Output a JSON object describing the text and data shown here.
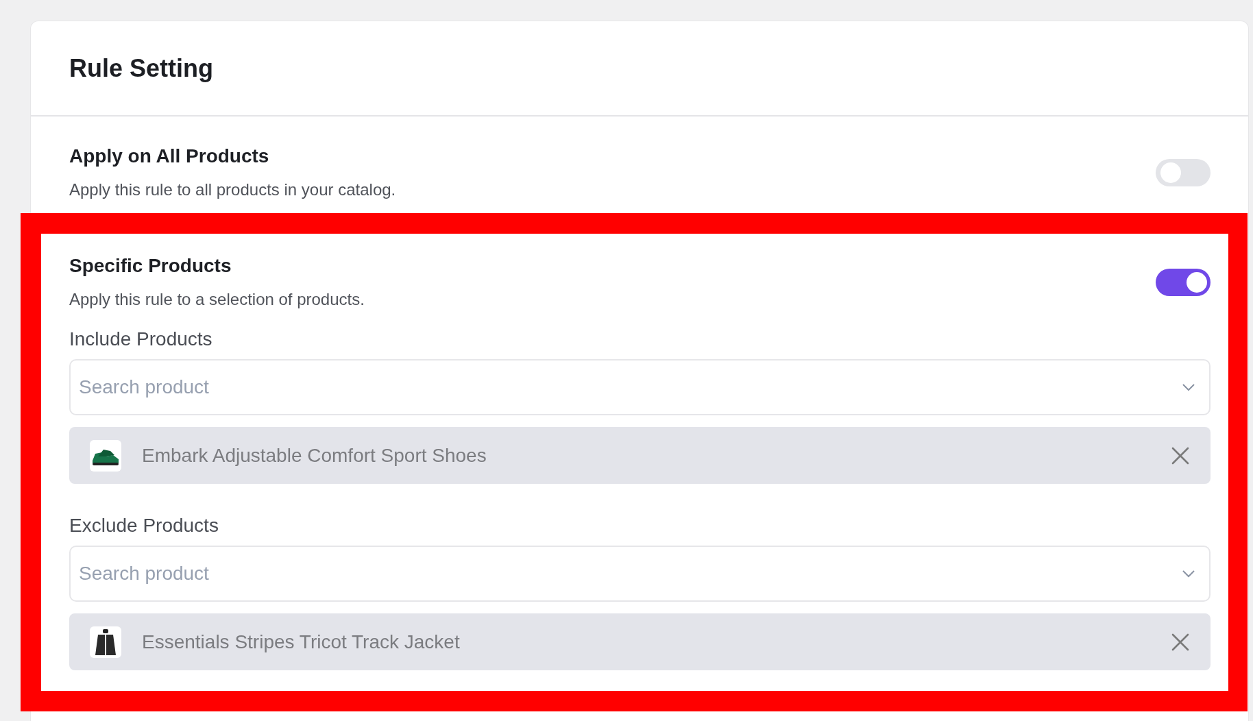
{
  "title": "Rule Setting",
  "rules": [
    {
      "title": "Apply on All Products",
      "description": "Apply this rule to all products in your catalog.",
      "on": false
    },
    {
      "title": "Specific Products",
      "description": "Apply this rule to a selection of products.",
      "on": true,
      "groups": [
        {
          "label": "Include Products",
          "placeholder": "Search product",
          "items": [
            {
              "name": "Embark Adjustable Comfort Sport Shoes"
            }
          ]
        },
        {
          "label": "Exclude Products",
          "placeholder": "Search product",
          "items": [
            {
              "name": "Essentials Stripes Tricot Track Jacket"
            }
          ]
        }
      ]
    }
  ]
}
